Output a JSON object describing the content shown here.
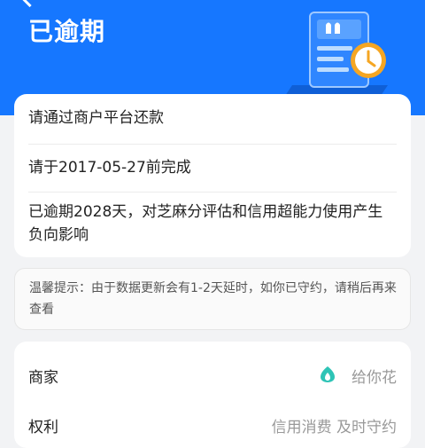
{
  "header": {
    "title": "已逾期"
  },
  "status_card": {
    "rows": [
      "请通过商户平台还款",
      "请于2017-05-27前完成",
      "已逾期2028天，对芝麻分评估和信用超能力使用产生负向影响"
    ]
  },
  "tip": {
    "text": "温馨提示：由于数据更新会有1-2天延时，如你已守约，请稍后再来查看"
  },
  "details": {
    "rows": [
      {
        "label": "商家",
        "value": "给你花",
        "icon": "merchant-logo-icon"
      },
      {
        "label": "权利",
        "value": "信用消费 及时守约"
      }
    ]
  },
  "colors": {
    "header_bg": "#1677ff",
    "brand_teal": "#2ec4b6",
    "clock_orange": "#f5a623"
  }
}
